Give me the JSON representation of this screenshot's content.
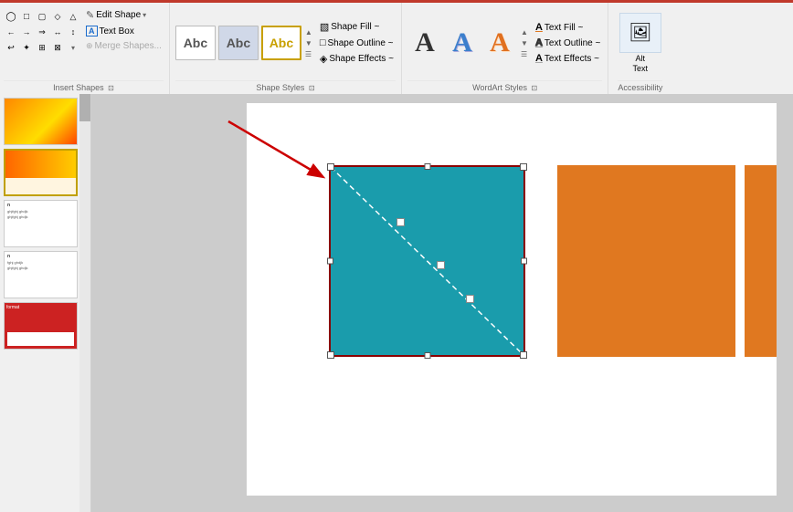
{
  "ribbon": {
    "redbar": true,
    "sections": {
      "insert_shapes": {
        "label": "Insert Shapes",
        "edit_shape_label": "Edit Shape",
        "text_box_label": "Text Box",
        "merge_shapes_label": "Merge Shapes..."
      },
      "shape_styles": {
        "label": "Shape Styles",
        "presets": [
          "Abc",
          "Abc",
          "Abc"
        ],
        "shape_fill_label": "Shape Fill ~",
        "shape_outline_label": "Shape Outline ~",
        "shape_effects_label": "Shape Effects ~"
      },
      "wordart_styles": {
        "label": "WordArt Styles",
        "letters": [
          "A",
          "A",
          "A"
        ],
        "text_fill_label": "Text Fill ~",
        "text_outline_label": "Text Outline ~",
        "text_effects_label": "Text Effects ~"
      },
      "accessibility": {
        "label": "Accessibility",
        "alt_text_label": "Alt\nText"
      }
    }
  },
  "slides": [
    {
      "id": 1,
      "type": "gradient"
    },
    {
      "id": 2,
      "type": "gradient"
    },
    {
      "id": 3,
      "type": "text",
      "text": "n\nghjfghj ghdjk\nghjfghj ghdjk"
    },
    {
      "id": 4,
      "type": "text2",
      "text": "n\nfghj ghdjk\nghjfghj ghdjk"
    },
    {
      "id": 5,
      "type": "red"
    }
  ],
  "canvas": {
    "teal_shape": {
      "color": "#1a9cac",
      "border_color": "#8b0000"
    },
    "orange_shape_1": {
      "color": "#e07820"
    },
    "orange_shape_2": {
      "color": "#e07820"
    }
  },
  "icons": {
    "edit_shape": "✎",
    "text_box": "☐",
    "merge": "⊕",
    "shape_fill": "▧",
    "shape_outline": "□",
    "shape_effects": "◈",
    "text_fill": "A",
    "text_outline": "A",
    "text_effects": "A",
    "dropdown": "▾",
    "expand": "⊡",
    "alt_text": "📷"
  }
}
